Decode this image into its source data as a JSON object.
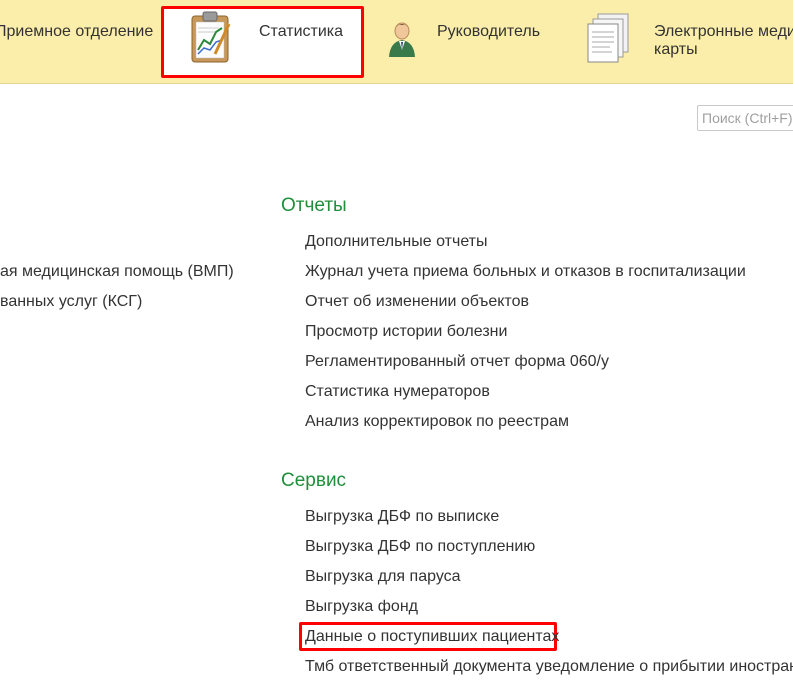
{
  "sections": [
    {
      "label": "Приемное отделение",
      "icon": "reception-icon",
      "active": false
    },
    {
      "label": "Статистика",
      "icon": "statistics-clipboard-icon",
      "active": true
    },
    {
      "label": "Руководитель",
      "icon": "manager-icon",
      "active": false
    },
    {
      "label_line1": "Электронные меди",
      "label_line2": "карты",
      "icon": "medical-records-icon",
      "active": false
    }
  ],
  "search": {
    "placeholder": "Поиск (Ctrl+F)"
  },
  "left_items": [
    "ая медицинская помощь (ВМП)",
    "ванных услуг (КСГ)"
  ],
  "reports": {
    "title": "Отчеты",
    "items": [
      "Дополнительные отчеты",
      "Журнал учета приема больных и отказов в госпитализации",
      "Отчет об изменении объектов",
      "Просмотр истории болезни",
      "Регламентированный отчет форма 060/у",
      "Статистика нумераторов",
      "Анализ корректировок по реестрам"
    ]
  },
  "service": {
    "title": "Сервис",
    "items": [
      "Выгрузка ДБФ по выписке",
      "Выгрузка ДБФ по поступлению",
      "Выгрузка для паруса",
      "Выгрузка фонд",
      "Данные о поступивших пациентах",
      "Тмб ответственный документа уведомление о прибытии иностранно"
    ]
  },
  "colors": {
    "section_bar": "#fbeeaa",
    "group_title": "#1f8f3a",
    "highlight": "#ff0000"
  }
}
